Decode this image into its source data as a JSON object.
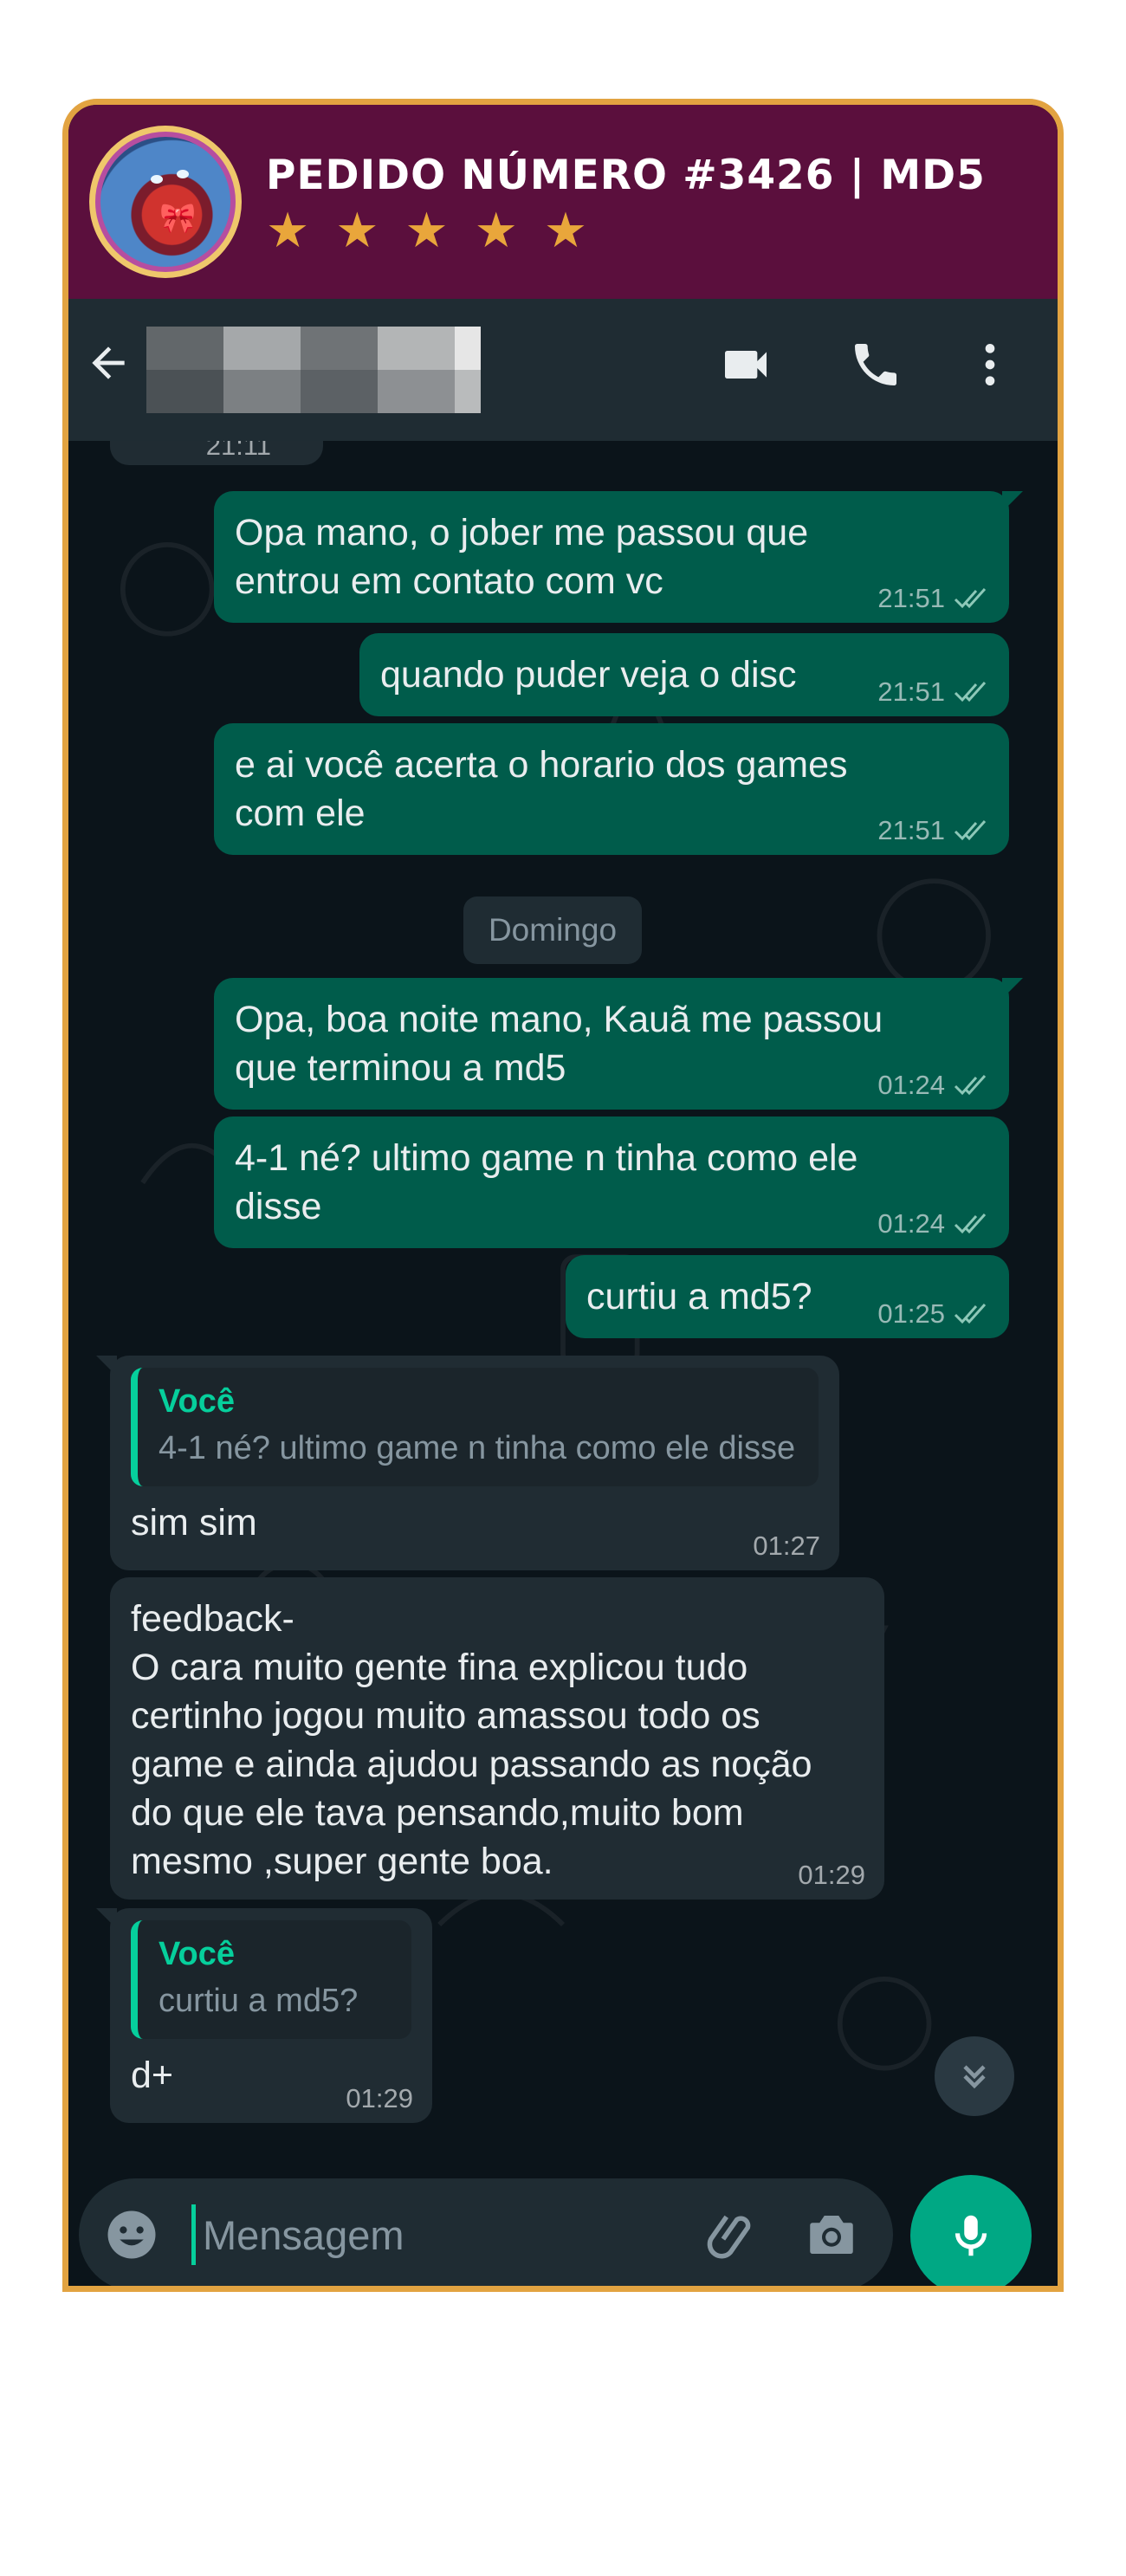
{
  "banner": {
    "title": "PEDIDO NÚMERO #3426 | MD5",
    "rating_stars": 5,
    "star_glyph": "★",
    "background_color": "#5b0f3d",
    "border_color": "#e2a341"
  },
  "header": {
    "contact_name_redacted": true,
    "icons": [
      "back-arrow-icon",
      "video-call-icon",
      "voice-call-icon",
      "more-options-icon"
    ]
  },
  "chat": {
    "partial_top_time": "21:11",
    "date_divider": "Domingo",
    "outgoing_color": "#005c4b",
    "incoming_color": "#202c33",
    "messages": [
      {
        "direction": "out",
        "text": "Opa mano, o jober me passou que\nentrou em contato com vc",
        "time": "21:51",
        "status": "read"
      },
      {
        "direction": "out",
        "text": "quando puder veja o disc",
        "time": "21:51",
        "status": "read"
      },
      {
        "direction": "out",
        "text": "e ai você acerta o horario dos games\ncom ele",
        "time": "21:51",
        "status": "read"
      },
      {
        "direction": "out",
        "text": "Opa, boa noite mano, Kauã me passou\nque terminou a md5",
        "time": "01:24",
        "status": "read"
      },
      {
        "direction": "out",
        "text": "4-1 né? ultimo game n tinha como ele\ndisse",
        "time": "01:24",
        "status": "read"
      },
      {
        "direction": "out",
        "text": "curtiu a md5?",
        "time": "01:25",
        "status": "read"
      },
      {
        "direction": "in",
        "quote_author": "Você",
        "quote_text": "4-1 né? ultimo game n tinha como ele disse",
        "text": "sim sim",
        "time": "01:27"
      },
      {
        "direction": "in",
        "text": "feedback-\nO cara muito gente fina explicou tudo\ncertinho jogou muito amassou todo os\ngame e ainda ajudou passando as noção\ndo que ele tava pensando,muito bom\nmesmo ,super gente boa.",
        "time": "01:29"
      },
      {
        "direction": "in",
        "quote_author": "Você",
        "quote_text": "curtiu a md5?",
        "text": "d+",
        "time": "01:29"
      }
    ]
  },
  "composer": {
    "placeholder": "Mensagem",
    "accent_color": "#00a884",
    "icons": [
      "emoji-icon",
      "attach-icon",
      "camera-icon",
      "mic-icon"
    ]
  }
}
